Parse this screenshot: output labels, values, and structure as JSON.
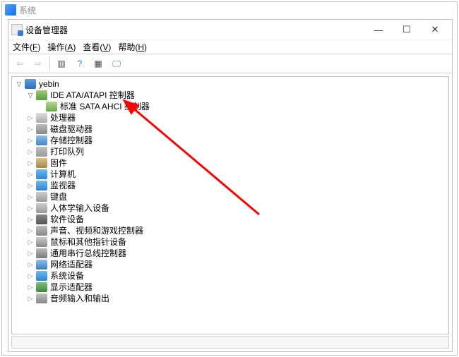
{
  "outer_window": {
    "title": "系统"
  },
  "inner_window": {
    "title": "设备管理器"
  },
  "window_controls": {
    "min": "—",
    "max": "☐",
    "close": "✕"
  },
  "menu": {
    "file": "文件(F)",
    "action": "操作(A)",
    "view": "查看(V)",
    "help": "帮助(H)"
  },
  "toolbar": {
    "back": "⇦",
    "forward": "⇨",
    "up": "▥",
    "help": "?",
    "refresh": "▦",
    "monitor": "🖵"
  },
  "tree": {
    "root": "yebin",
    "ide": {
      "label": "IDE ATA/ATAPI 控制器",
      "child": "标准 SATA AHCI 控制器"
    },
    "nodes": [
      {
        "label": "处理器",
        "icon": "cpu"
      },
      {
        "label": "磁盘驱动器",
        "icon": "disk"
      },
      {
        "label": "存储控制器",
        "icon": "storage"
      },
      {
        "label": "打印队列",
        "icon": "printq"
      },
      {
        "label": "固件",
        "icon": "firmware"
      },
      {
        "label": "计算机",
        "icon": "pc"
      },
      {
        "label": "监视器",
        "icon": "monitor"
      },
      {
        "label": "键盘",
        "icon": "keyboard"
      },
      {
        "label": "人体学输入设备",
        "icon": "hid"
      },
      {
        "label": "软件设备",
        "icon": "software"
      },
      {
        "label": "声音、视频和游戏控制器",
        "icon": "audio"
      },
      {
        "label": "鼠标和其他指针设备",
        "icon": "mouse"
      },
      {
        "label": "通用串行总线控制器",
        "icon": "usb"
      },
      {
        "label": "网络适配器",
        "icon": "net"
      },
      {
        "label": "系统设备",
        "icon": "system"
      },
      {
        "label": "显示适配器",
        "icon": "display"
      },
      {
        "label": "音频输入和输出",
        "icon": "audio2"
      }
    ]
  }
}
